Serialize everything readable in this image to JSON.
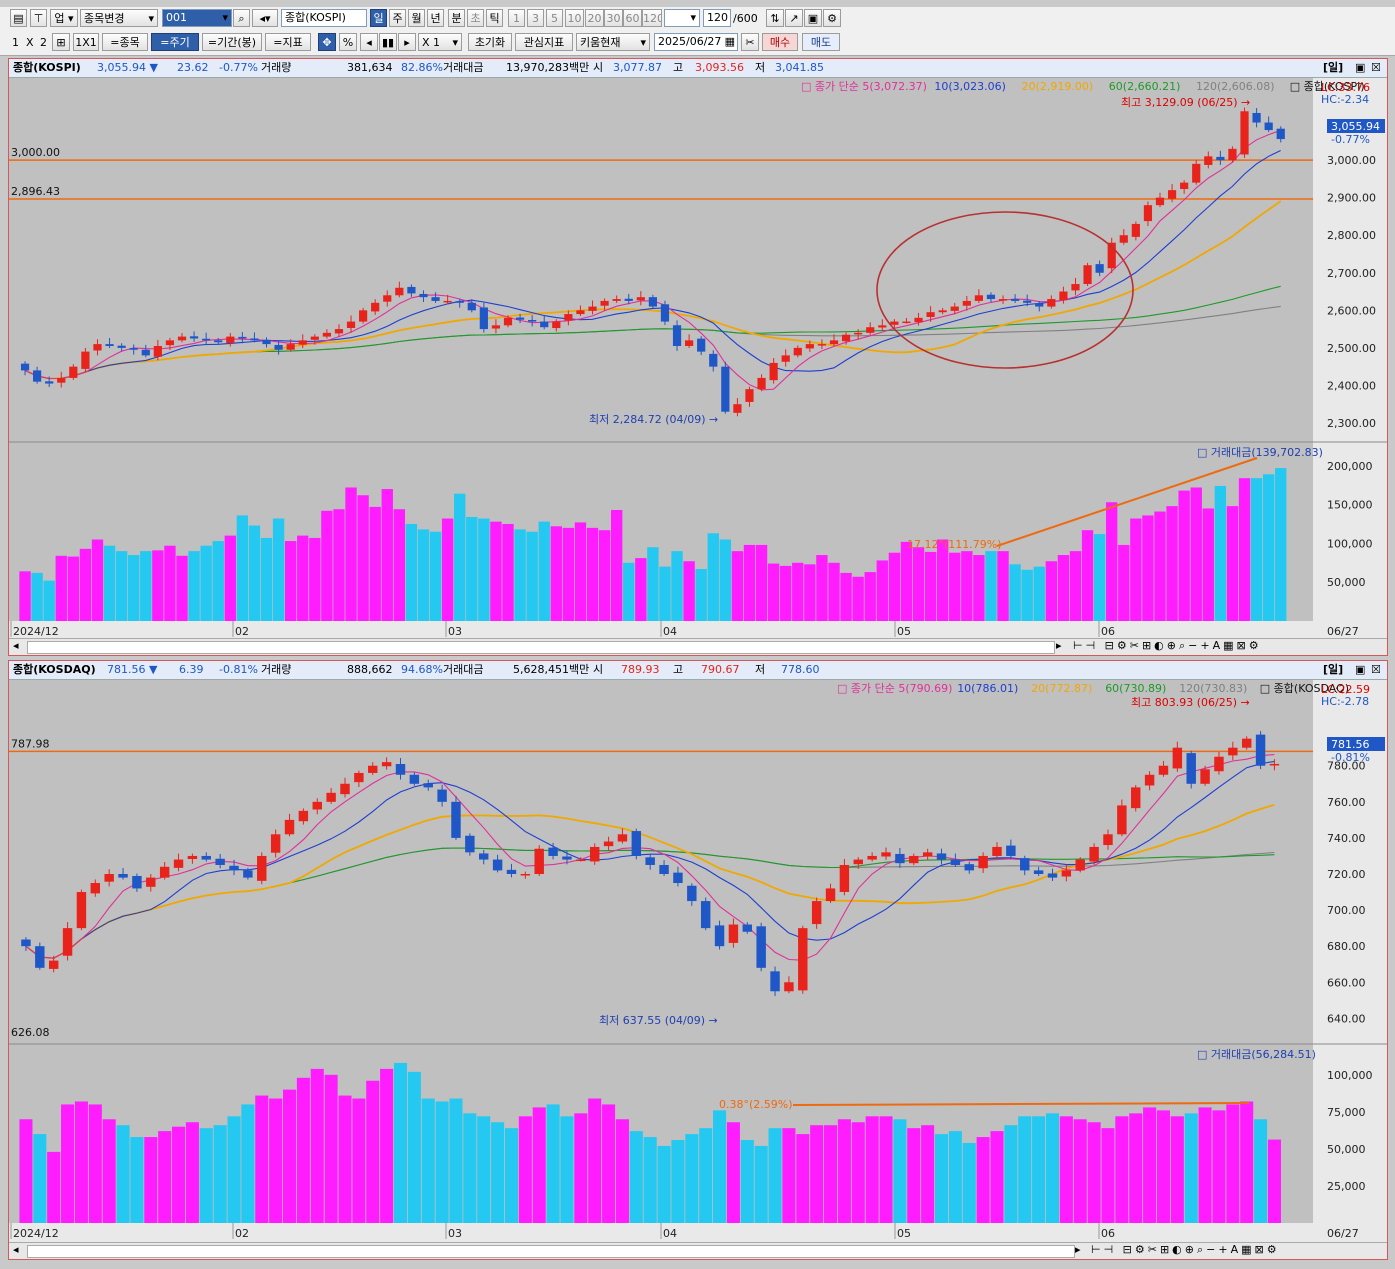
{
  "toolbar1": {
    "menu_up": "업",
    "change_item": "종목변경",
    "code": "001",
    "item_name": "종합(KOSPI)",
    "period_tabs": [
      "일",
      "주",
      "월",
      "년",
      "분",
      "초",
      "틱"
    ],
    "num_tabs": [
      "1",
      "3",
      "5",
      "10",
      "20",
      "30",
      "60",
      "120"
    ],
    "count": "120",
    "count_total": "/600"
  },
  "toolbar2": {
    "layout": [
      "1",
      "X",
      "2"
    ],
    "layout_1x1": "1X1",
    "btn_item": "=종목",
    "btn_cycle": "=주기",
    "btn_period": "=기간(봉)",
    "btn_indicator": "=지표",
    "btn_percent": "%",
    "multiplier": "X 1",
    "btn_reset": "초기화",
    "btn_watch": "관심지표",
    "btn_kiwoom": "키움현재",
    "date": "2025/06/27",
    "btn_buy": "매수",
    "btn_sell": "매도"
  },
  "panels": [
    {
      "name": "종합(KOSPI)",
      "price": "3,055.94 ▼",
      "change": "23.62",
      "change_pct": "-0.77%",
      "vol_label": "거래량",
      "vol": "381,634",
      "vol_pct": "82.86%",
      "amt_label": "거래대금",
      "amt": "13,970,283백만",
      "open_label": "시",
      "open": "3,077.87",
      "high_label": "고",
      "high": "3,093.56",
      "low_label": "저",
      "low": "3,041.85",
      "period_tag": "[일]",
      "legend": {
        "ma_label": "종가 단순",
        "ma5": "5(3,072.37)",
        "ma10": "10(3,023.06)",
        "ma20": "20(2,919.00)",
        "ma60": "60(2,660.21)",
        "ma120": "120(2,606.08)",
        "series": "종합(KOSPI)"
      },
      "lc": "LC:33.76",
      "hc": "HC:-2.34",
      "cur_price": "3,055.94",
      "cur_pct": "-0.77%",
      "max_label": "최고 3,129.09 (06/25)",
      "min_label": "최저 2,284.72 (04/09)",
      "hline_labels": [
        "3,000.00",
        "2,896.43"
      ],
      "price_ticks": [
        "3,000.00",
        "2,900.00",
        "2,800.00",
        "2,700.00",
        "2,600.00",
        "2,500.00",
        "2,400.00",
        "2,300.00"
      ],
      "vol_legend": "거래대금(139,702.83)",
      "vol_ticks": [
        "200,000",
        "150,000",
        "100,000",
        "50,000"
      ],
      "trend_label": "17.12°(111.79%)",
      "dates": [
        "2024/12",
        "02",
        "03",
        "04",
        "05",
        "06"
      ],
      "last_date": "06/27"
    },
    {
      "name": "종합(KOSDAQ)",
      "price": "781.56 ▼",
      "change": "6.39",
      "change_pct": "-0.81%",
      "vol_label": "거래량",
      "vol": "888,662",
      "vol_pct": "94.68%",
      "amt_label": "거래대금",
      "amt": "5,628,451백만",
      "open_label": "시",
      "open": "789.93",
      "high_label": "고",
      "high": "790.67",
      "low_label": "저",
      "low": "778.60",
      "period_tag": "[일]",
      "legend": {
        "ma_label": "종가 단순",
        "ma5": "5(790.69)",
        "ma10": "10(786.01)",
        "ma20": "20(772.87)",
        "ma60": "60(730.89)",
        "ma120": "120(730.83)",
        "series": "종합(KOSDAQ)"
      },
      "lc": "LC:22.59",
      "hc": "HC:-2.78",
      "cur_price": "781.56",
      "cur_pct": "-0.81%",
      "max_label": "최고 803.93 (06/25)",
      "min_label": "최저 637.55 (04/09)",
      "hline_labels": [
        "787.98",
        "626.08"
      ],
      "price_ticks": [
        "780.00",
        "760.00",
        "740.00",
        "720.00",
        "700.00",
        "680.00",
        "660.00",
        "640.00"
      ],
      "vol_legend": "거래대금(56,284.51)",
      "vol_ticks": [
        "100,000",
        "75,000",
        "50,000",
        "25,000"
      ],
      "trend_label": "0.38°(2.59%)",
      "dates": [
        "2024/12",
        "02",
        "03",
        "04",
        "05",
        "06"
      ],
      "last_date": "06/27"
    }
  ],
  "colors": {
    "up": "#e8231b",
    "down": "#1f57c7",
    "vol_up": "#ff1cff",
    "vol_down": "#24c8f0",
    "ma5": "#e0309a",
    "ma10": "#1e3fd0",
    "ma20": "#f0a800",
    "ma60": "#1e9a2a",
    "ma120": "#808080",
    "hline": "#ee6a10"
  },
  "chart_data": [
    {
      "type": "candlestick",
      "title": "종합(KOSPI)",
      "x_range": [
        "2024/12",
        "06/27"
      ],
      "ylim": [
        2260,
        3160
      ],
      "vol_ylim": [
        0,
        210000
      ],
      "close": [
        2440,
        2410,
        2405,
        2420,
        2450,
        2490,
        2510,
        2505,
        2500,
        2495,
        2480,
        2505,
        2520,
        2530,
        2525,
        2520,
        2515,
        2530,
        2525,
        2520,
        2510,
        2495,
        2510,
        2520,
        2530,
        2540,
        2550,
        2570,
        2600,
        2620,
        2640,
        2660,
        2645,
        2635,
        2625,
        2625,
        2620,
        2600,
        2550,
        2560,
        2580,
        2575,
        2570,
        2555,
        2570,
        2590,
        2600,
        2610,
        2625,
        2630,
        2625,
        2635,
        2610,
        2570,
        2505,
        2520,
        2490,
        2450,
        2330,
        2350,
        2390,
        2420,
        2460,
        2480,
        2500,
        2510,
        2510,
        2520,
        2535,
        2540,
        2555,
        2560,
        2570,
        2570,
        2580,
        2595,
        2600,
        2610,
        2625,
        2640,
        2630,
        2630,
        2625,
        2620,
        2610,
        2630,
        2650,
        2670,
        2720,
        2700,
        2780,
        2800,
        2830,
        2880,
        2900,
        2920,
        2940,
        2990,
        3010,
        3000,
        3030,
        3130,
        3100,
        3080,
        3056
      ],
      "vol": [
        64000,
        62000,
        52000,
        84000,
        83000,
        93000,
        105000,
        97000,
        90000,
        85000,
        90000,
        91000,
        97000,
        84000,
        90000,
        97000,
        103000,
        110000,
        136000,
        123000,
        107000,
        132000,
        103000,
        110000,
        107000,
        142000,
        144000,
        172000,
        162000,
        147000,
        170000,
        144000,
        125000,
        118000,
        115000,
        132000,
        164000,
        134000,
        132000,
        128000,
        125000,
        118000,
        115000,
        128000,
        122000,
        120000,
        127000,
        120000,
        117000,
        143000,
        75000,
        81000,
        95000,
        70000,
        90000,
        77000,
        67000,
        113000,
        105000,
        90000,
        98000,
        98000,
        74000,
        71000,
        75000,
        73000,
        85000,
        75000,
        62000,
        57000,
        63000,
        78000,
        88000,
        102000,
        95000,
        89000,
        105000,
        88000,
        90000,
        85000,
        90000,
        90000,
        73000,
        66000,
        70000,
        77000,
        85000,
        90000,
        117000,
        112000,
        153000,
        98000,
        132000,
        136000,
        141000,
        148000,
        168000,
        172000,
        145000,
        174000,
        148000,
        184000,
        184000,
        189000,
        197000,
        171000,
        139703
      ]
    },
    {
      "type": "candlestick",
      "title": "종합(KOSDAQ)",
      "x_range": [
        "2024/12",
        "06/27"
      ],
      "ylim": [
        628,
        812
      ],
      "vol_ylim": [
        0,
        110000
      ],
      "close": [
        680,
        668,
        672,
        690,
        710,
        715,
        720,
        718,
        712,
        718,
        724,
        728,
        730,
        728,
        725,
        722,
        718,
        730,
        742,
        750,
        755,
        760,
        765,
        770,
        776,
        780,
        782,
        775,
        770,
        768,
        760,
        740,
        732,
        728,
        722,
        720,
        720,
        734,
        730,
        728,
        728,
        735,
        738,
        742,
        730,
        725,
        720,
        715,
        705,
        690,
        680,
        692,
        688,
        668,
        655,
        660,
        690,
        705,
        712,
        725,
        728,
        730,
        732,
        726,
        730,
        732,
        728,
        725,
        722,
        730,
        735,
        730,
        722,
        720,
        718,
        722,
        728,
        735,
        742,
        758,
        768,
        775,
        780,
        790,
        770,
        778,
        785,
        790,
        795,
        780,
        781
      ],
      "vol": [
        70000,
        60000,
        48000,
        80000,
        82000,
        80000,
        70000,
        66000,
        58000,
        58000,
        62000,
        65000,
        68000,
        64000,
        66000,
        72000,
        80000,
        86000,
        84000,
        90000,
        98000,
        104000,
        100000,
        86000,
        84000,
        96000,
        104000,
        108000,
        102000,
        84000,
        82000,
        84000,
        74000,
        72000,
        68000,
        64000,
        72000,
        78000,
        80000,
        72000,
        74000,
        84000,
        80000,
        70000,
        62000,
        58000,
        52000,
        56000,
        60000,
        64000,
        76000,
        68000,
        56000,
        52000,
        64000,
        64000,
        60000,
        66000,
        66000,
        70000,
        68000,
        72000,
        72000,
        70000,
        64000,
        66000,
        60000,
        62000,
        54000,
        58000,
        62000,
        66000,
        72000,
        72000,
        74000,
        72000,
        70000,
        68000,
        64000,
        72000,
        74000,
        78000,
        76000,
        72000,
        74000,
        78000,
        76000,
        80000,
        82000,
        70000,
        56285
      ]
    }
  ]
}
